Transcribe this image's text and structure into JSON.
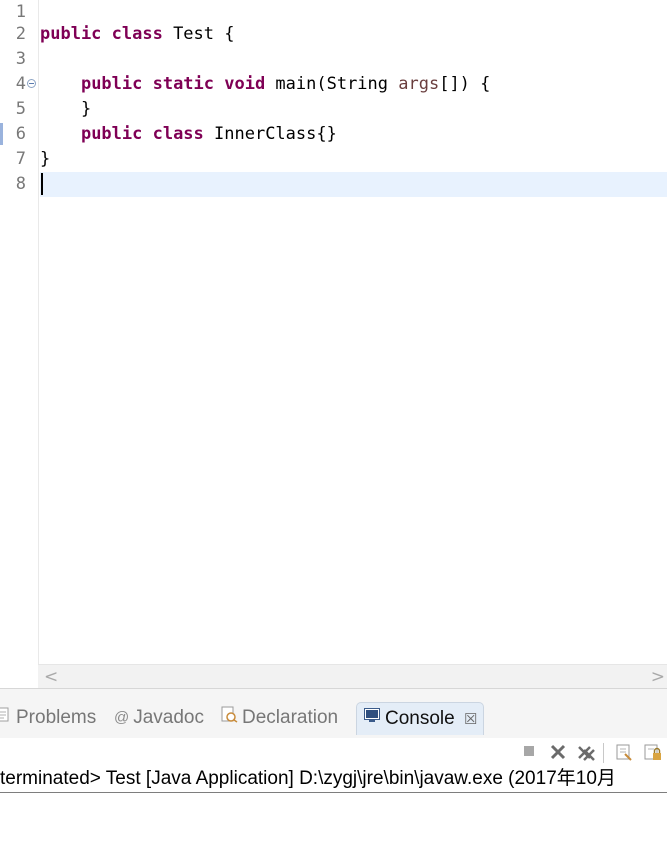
{
  "editor": {
    "line_numbers": [
      "1",
      "2",
      "3",
      "4",
      "5",
      "6",
      "7",
      "8"
    ],
    "lines": [
      [],
      [
        {
          "t": "public class",
          "c": "kw"
        },
        {
          "t": " Test {"
        }
      ],
      [],
      [
        {
          "t": "    "
        },
        {
          "t": "public static void",
          "c": "kw"
        },
        {
          "t": " main(String "
        },
        {
          "t": "args",
          "c": "param"
        },
        {
          "t": "[]) {"
        }
      ],
      [
        {
          "t": "    }"
        }
      ],
      [
        {
          "t": "    "
        },
        {
          "t": "public class",
          "c": "kw"
        },
        {
          "t": " InnerClass{}"
        }
      ],
      [
        {
          "t": "}"
        }
      ],
      []
    ],
    "current_line": 8
  },
  "scrollbar": {
    "left_arrow": "<",
    "right_arrow": ">"
  },
  "tabs": [
    {
      "id": "problems",
      "label": "Problems",
      "icon": "problems-icon",
      "active": false
    },
    {
      "id": "javadoc",
      "label": "Javadoc",
      "icon": "javadoc-icon",
      "active": false
    },
    {
      "id": "declaration",
      "label": "Declaration",
      "icon": "declaration-icon",
      "active": false
    },
    {
      "id": "console",
      "label": "Console",
      "icon": "console-icon",
      "active": true,
      "close": "☒"
    }
  ],
  "console": {
    "status": "terminated> Test [Java Application] D:\\zygj\\jre\\bin\\javaw.exe (2017年10月",
    "toolbar": [
      "stop-icon",
      "remove-launch-icon",
      "remove-all-icon",
      "clear-console-icon",
      "scroll-lock-icon"
    ]
  },
  "colors": {
    "keyword": "#7f0055",
    "parameter": "#6a3e3e",
    "current_line": "#e8f2fe",
    "active_tab": "#e4edf7"
  }
}
